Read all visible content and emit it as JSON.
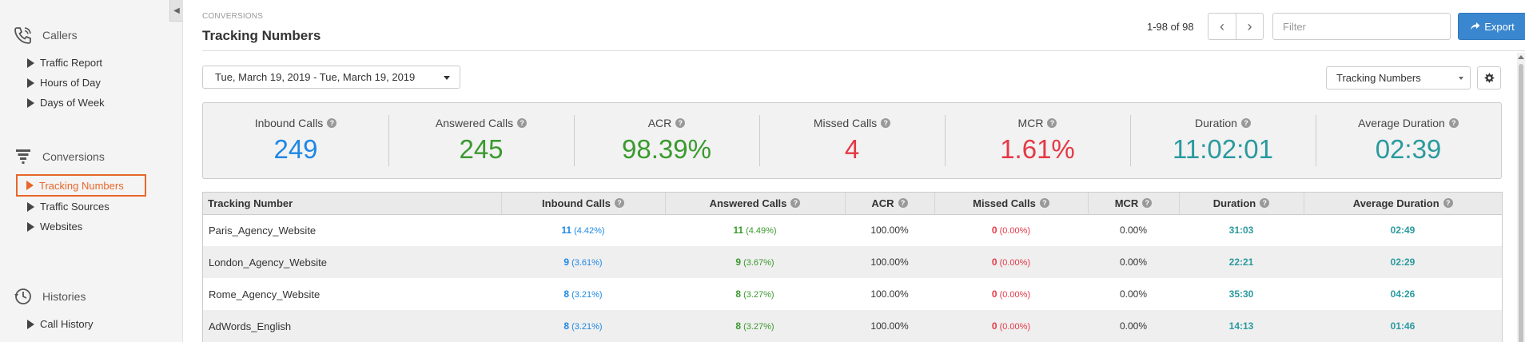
{
  "colors": {
    "accent": "#e8662a",
    "blue": "#1e88e5",
    "green": "#3a9a2e",
    "red": "#e53945",
    "teal": "#2a9a9e",
    "export_bg": "#3a87cf"
  },
  "sidebar": {
    "groups": [
      {
        "title": "Callers",
        "icon": "phone-icon",
        "items": [
          {
            "label": "Traffic Report"
          },
          {
            "label": "Hours of Day"
          },
          {
            "label": "Days of Week"
          }
        ]
      },
      {
        "title": "Conversions",
        "icon": "funnel-icon",
        "items": [
          {
            "label": "Tracking Numbers",
            "active": true
          },
          {
            "label": "Traffic Sources"
          },
          {
            "label": "Websites"
          }
        ]
      },
      {
        "title": "Histories",
        "icon": "history-icon",
        "items": [
          {
            "label": "Call History"
          }
        ]
      }
    ]
  },
  "header": {
    "breadcrumb": "Conversions",
    "title": "Tracking Numbers",
    "pager_text": "1-98 of 98",
    "filter_placeholder": "Filter",
    "export_label": "Export"
  },
  "toolbar": {
    "date_range": "Tue, March 19, 2019 - Tue, March 19, 2019",
    "view_select": "Tracking Numbers"
  },
  "stats": [
    {
      "label": "Inbound Calls",
      "value": "249",
      "color": "blue"
    },
    {
      "label": "Answered Calls",
      "value": "245",
      "color": "green"
    },
    {
      "label": "ACR",
      "value": "98.39%",
      "color": "green"
    },
    {
      "label": "Missed Calls",
      "value": "4",
      "color": "red"
    },
    {
      "label": "MCR",
      "value": "1.61%",
      "color": "red"
    },
    {
      "label": "Duration",
      "value": "11:02:01",
      "color": "teal"
    },
    {
      "label": "Average Duration",
      "value": "02:39",
      "color": "teal"
    }
  ],
  "table": {
    "columns": [
      {
        "label": "Tracking Number",
        "help": false
      },
      {
        "label": "Inbound Calls",
        "help": true
      },
      {
        "label": "Answered Calls",
        "help": true
      },
      {
        "label": "ACR",
        "help": true
      },
      {
        "label": "Missed Calls",
        "help": true
      },
      {
        "label": "MCR",
        "help": true
      },
      {
        "label": "Duration",
        "help": true
      },
      {
        "label": "Average Duration",
        "help": true
      }
    ],
    "rows": [
      {
        "name": "Paris_Agency_Website",
        "inbound": "11",
        "inbound_pct": "(4.42%)",
        "answered": "11",
        "answered_pct": "(4.49%)",
        "acr": "100.00%",
        "missed": "0",
        "missed_pct": "(0.00%)",
        "mcr": "0.00%",
        "duration": "31:03",
        "avg_duration": "02:49"
      },
      {
        "name": "London_Agency_Website",
        "inbound": "9",
        "inbound_pct": "(3.61%)",
        "answered": "9",
        "answered_pct": "(3.67%)",
        "acr": "100.00%",
        "missed": "0",
        "missed_pct": "(0.00%)",
        "mcr": "0.00%",
        "duration": "22:21",
        "avg_duration": "02:29"
      },
      {
        "name": "Rome_Agency_Website",
        "inbound": "8",
        "inbound_pct": "(3.21%)",
        "answered": "8",
        "answered_pct": "(3.27%)",
        "acr": "100.00%",
        "missed": "0",
        "missed_pct": "(0.00%)",
        "mcr": "0.00%",
        "duration": "35:30",
        "avg_duration": "04:26"
      },
      {
        "name": "AdWords_English",
        "inbound": "8",
        "inbound_pct": "(3.21%)",
        "answered": "8",
        "answered_pct": "(3.27%)",
        "acr": "100.00%",
        "missed": "0",
        "missed_pct": "(0.00%)",
        "mcr": "0.00%",
        "duration": "14:13",
        "avg_duration": "01:46"
      }
    ]
  }
}
